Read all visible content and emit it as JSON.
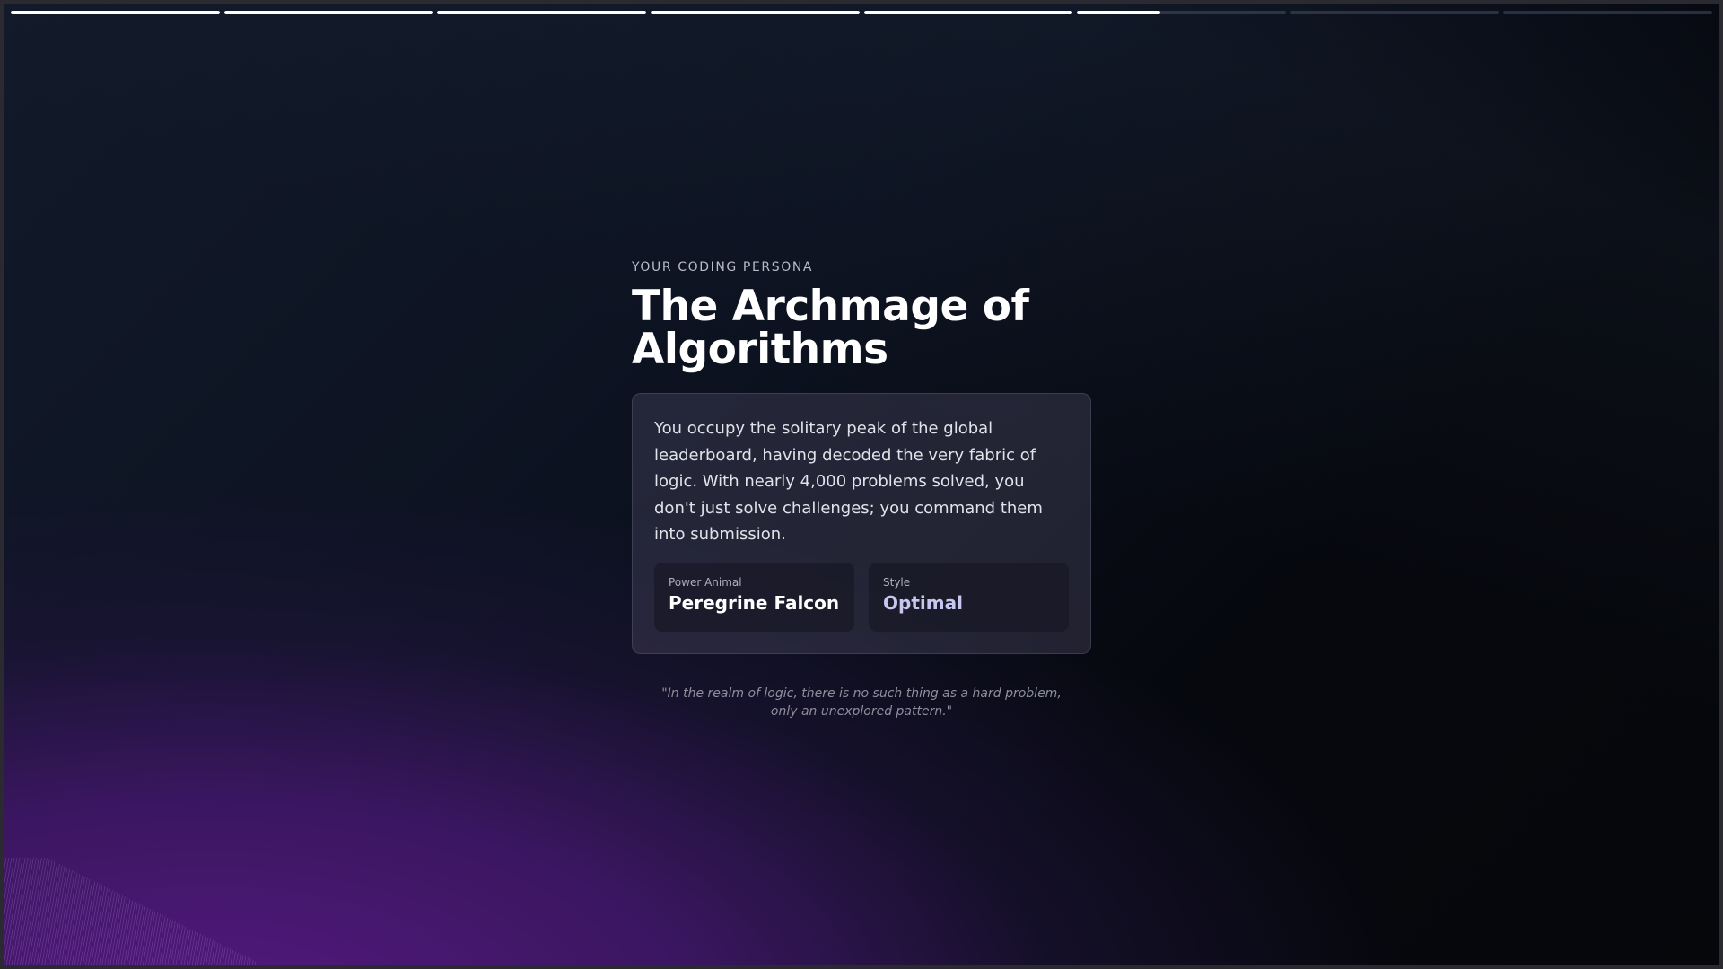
{
  "story_progress": {
    "segments": [
      1,
      1,
      1,
      1,
      1,
      0.4,
      0,
      0
    ]
  },
  "persona": {
    "eyebrow": "YOUR CODING PERSONA",
    "title": "The Archmage of Algorithms",
    "description": "You occupy the solitary peak of the global leaderboard, having decoded the very fabric of logic. With nearly 4,000 problems solved, you don't just solve challenges; you command them into submission.",
    "stats": [
      {
        "label": "Power Animal",
        "value": "Peregrine Falcon"
      },
      {
        "label": "Style",
        "value": "Optimal"
      }
    ],
    "quote": "\"In the realm of logic, there is no such thing as a hard problem, only an unexplored pattern.\""
  },
  "colors": {
    "accent_purple": "#54197f",
    "style_value": "#c7c6f0"
  }
}
